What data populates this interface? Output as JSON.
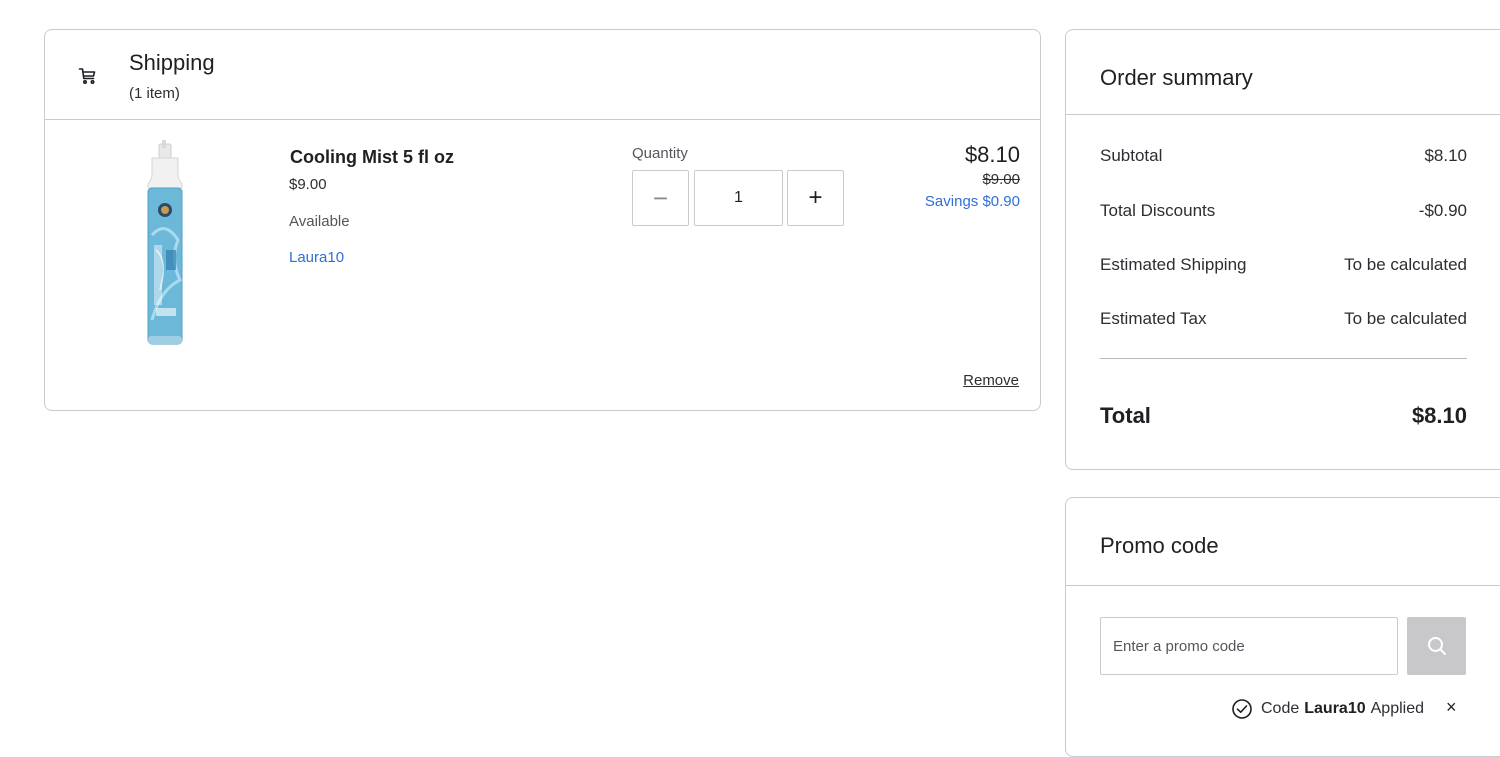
{
  "shipping": {
    "title": "Shipping",
    "item_count": "(1 item)",
    "icon": "cart-icon"
  },
  "cart_item": {
    "name": "Cooling Mist 5 fl oz",
    "unit_price": "$9.00",
    "availability": "Available",
    "promo_code": "Laura10",
    "quantity_label": "Quantity",
    "quantity": "1",
    "decrement": "−",
    "increment": "+",
    "price": "$8.10",
    "original_price": "$9.00",
    "savings": "Savings $0.90",
    "remove_label": "Remove"
  },
  "summary": {
    "title": "Order summary",
    "rows": [
      {
        "label": "Subtotal",
        "value": "$8.10"
      },
      {
        "label": "Total Discounts",
        "value": "-$0.90"
      },
      {
        "label": "Estimated Shipping",
        "value": "To be calculated"
      },
      {
        "label": "Estimated Tax",
        "value": "To be calculated"
      }
    ],
    "total_label": "Total",
    "total_value": "$8.10"
  },
  "promo": {
    "title": "Promo code",
    "placeholder": "Enter a promo code",
    "value": "",
    "applied_prefix": "Code",
    "applied_code": "Laura10",
    "applied_suffix": "Applied",
    "clear_label": "×"
  },
  "colors": {
    "link_blue": "#2f6fd6",
    "border": "#c9cbcf",
    "search_button": "#c8c8ca"
  }
}
